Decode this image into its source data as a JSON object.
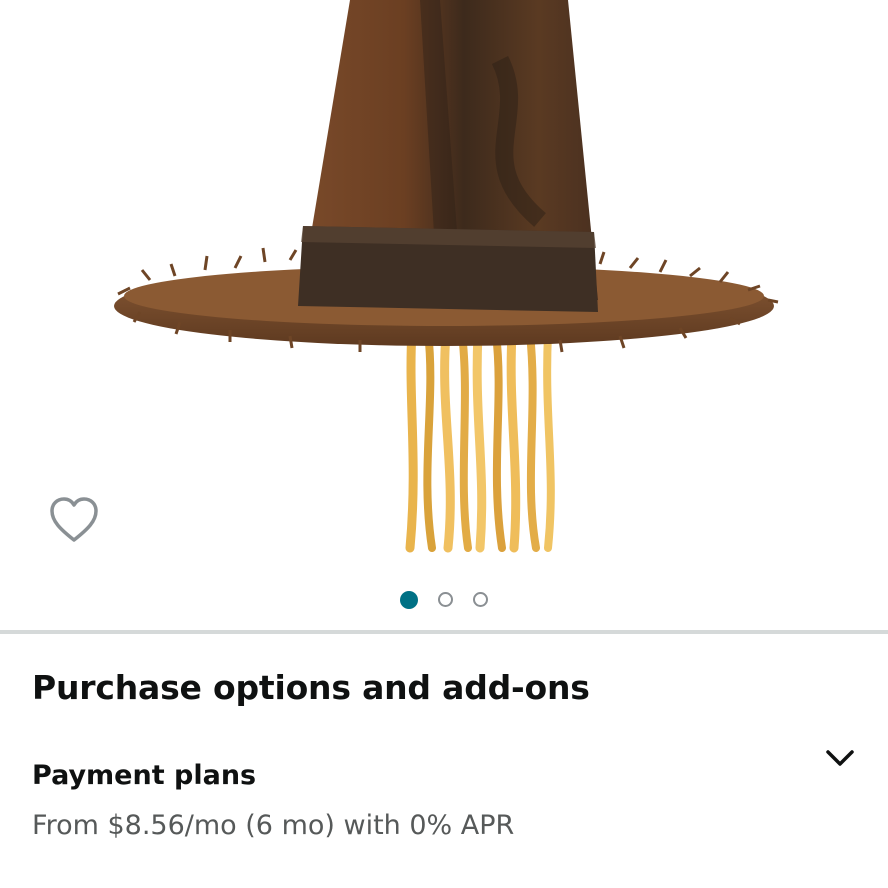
{
  "product": {
    "image_alt": "Brown witch hat piñata with gold pull ribbons",
    "gallery": {
      "dot_count": 3,
      "active_index": 0,
      "active_color": "#007185"
    }
  },
  "wishlist": {
    "icon": "heart-outline-icon"
  },
  "purchase_options": {
    "title": "Purchase options and add-ons",
    "payment_plans": {
      "label": "Payment plans",
      "detail": "From $8.56/mo (6 mo) with 0% APR",
      "expand_icon": "chevron-down-icon"
    }
  }
}
